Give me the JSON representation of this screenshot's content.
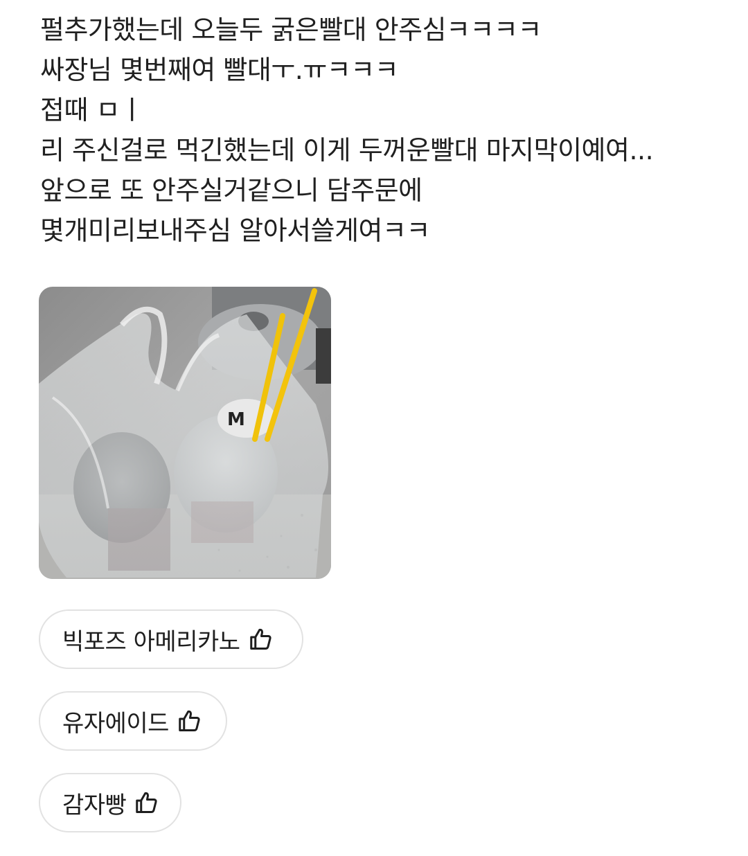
{
  "review": {
    "lines": [
      "펄추가했는데 오늘두 굵은빨대 안주심ㅋㅋㅋㅋ",
      "싸장님 몇번째여 빨대ㅜ.ㅠㅋㅋㅋ",
      "접때 ㅁㅣ",
      "리 주신걸로 먹긴했는데 이게 두꺼운빨대 마지막이예여...",
      "앞으로 또 안주실거같으니 담주문에",
      "몇개미리보내주심 알아서쓸게여ㅋㅋ"
    ]
  },
  "photo": {
    "icon": "review-photo"
  },
  "tags": [
    {
      "label": "빅포즈 아메리카노",
      "icon": "thumbs-up-icon"
    },
    {
      "label": "유자에이드",
      "icon": "thumbs-up-icon"
    },
    {
      "label": "감자빵",
      "icon": "thumbs-up-icon"
    }
  ]
}
